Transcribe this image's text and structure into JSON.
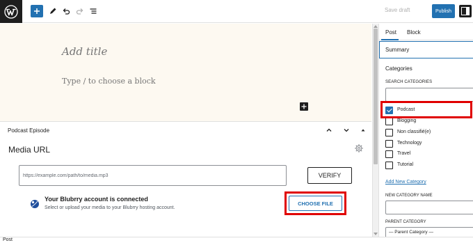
{
  "toolbar": {
    "save_draft": "Save draft",
    "publish": "Publish"
  },
  "editor": {
    "title_placeholder": "Add title",
    "block_placeholder": "Type / to choose a block"
  },
  "metabox": {
    "header": "Podcast Episode",
    "title": "Media URL",
    "url_placeholder": "https://example.com/path/to/media.mp3",
    "verify_label": "VERIFY",
    "account_title": "Your Blubrry account is connected",
    "account_subtitle": "Select or upload your media to your Blubrry hosting account.",
    "choose_file_label": "CHOOSE FILE"
  },
  "sidebar": {
    "tabs": [
      "Post",
      "Block"
    ],
    "summary": "Summary",
    "categories_heading": "Categories",
    "search_label": "SEARCH CATEGORIES",
    "categories": [
      {
        "label": "Podcast",
        "checked": true
      },
      {
        "label": "Blogging",
        "checked": false
      },
      {
        "label": "Non classifié(e)",
        "checked": false
      },
      {
        "label": "Technology",
        "checked": false
      },
      {
        "label": "Travel",
        "checked": false
      },
      {
        "label": "Tutorial",
        "checked": false
      }
    ],
    "add_new_category": "Add New Category",
    "new_category_label": "NEW CATEGORY NAME",
    "parent_category_label": "PARENT CATEGORY",
    "parent_category_value": "— Parent Category —"
  },
  "footer": {
    "breadcrumb": "Post"
  },
  "colors": {
    "accent": "#2271b1",
    "highlight": "#e00000",
    "canvas_bg": "#fdf9f1"
  },
  "icons": {
    "logo": "wordpress-logo-icon",
    "add": "plus-icon",
    "tools": "pencil-icon",
    "undo": "undo-icon",
    "redo": "redo-icon",
    "outline": "list-view-icon",
    "settings": "sidebar-toggle-icon",
    "gear": "gear-icon",
    "blubrry": "blubrry-icon"
  }
}
